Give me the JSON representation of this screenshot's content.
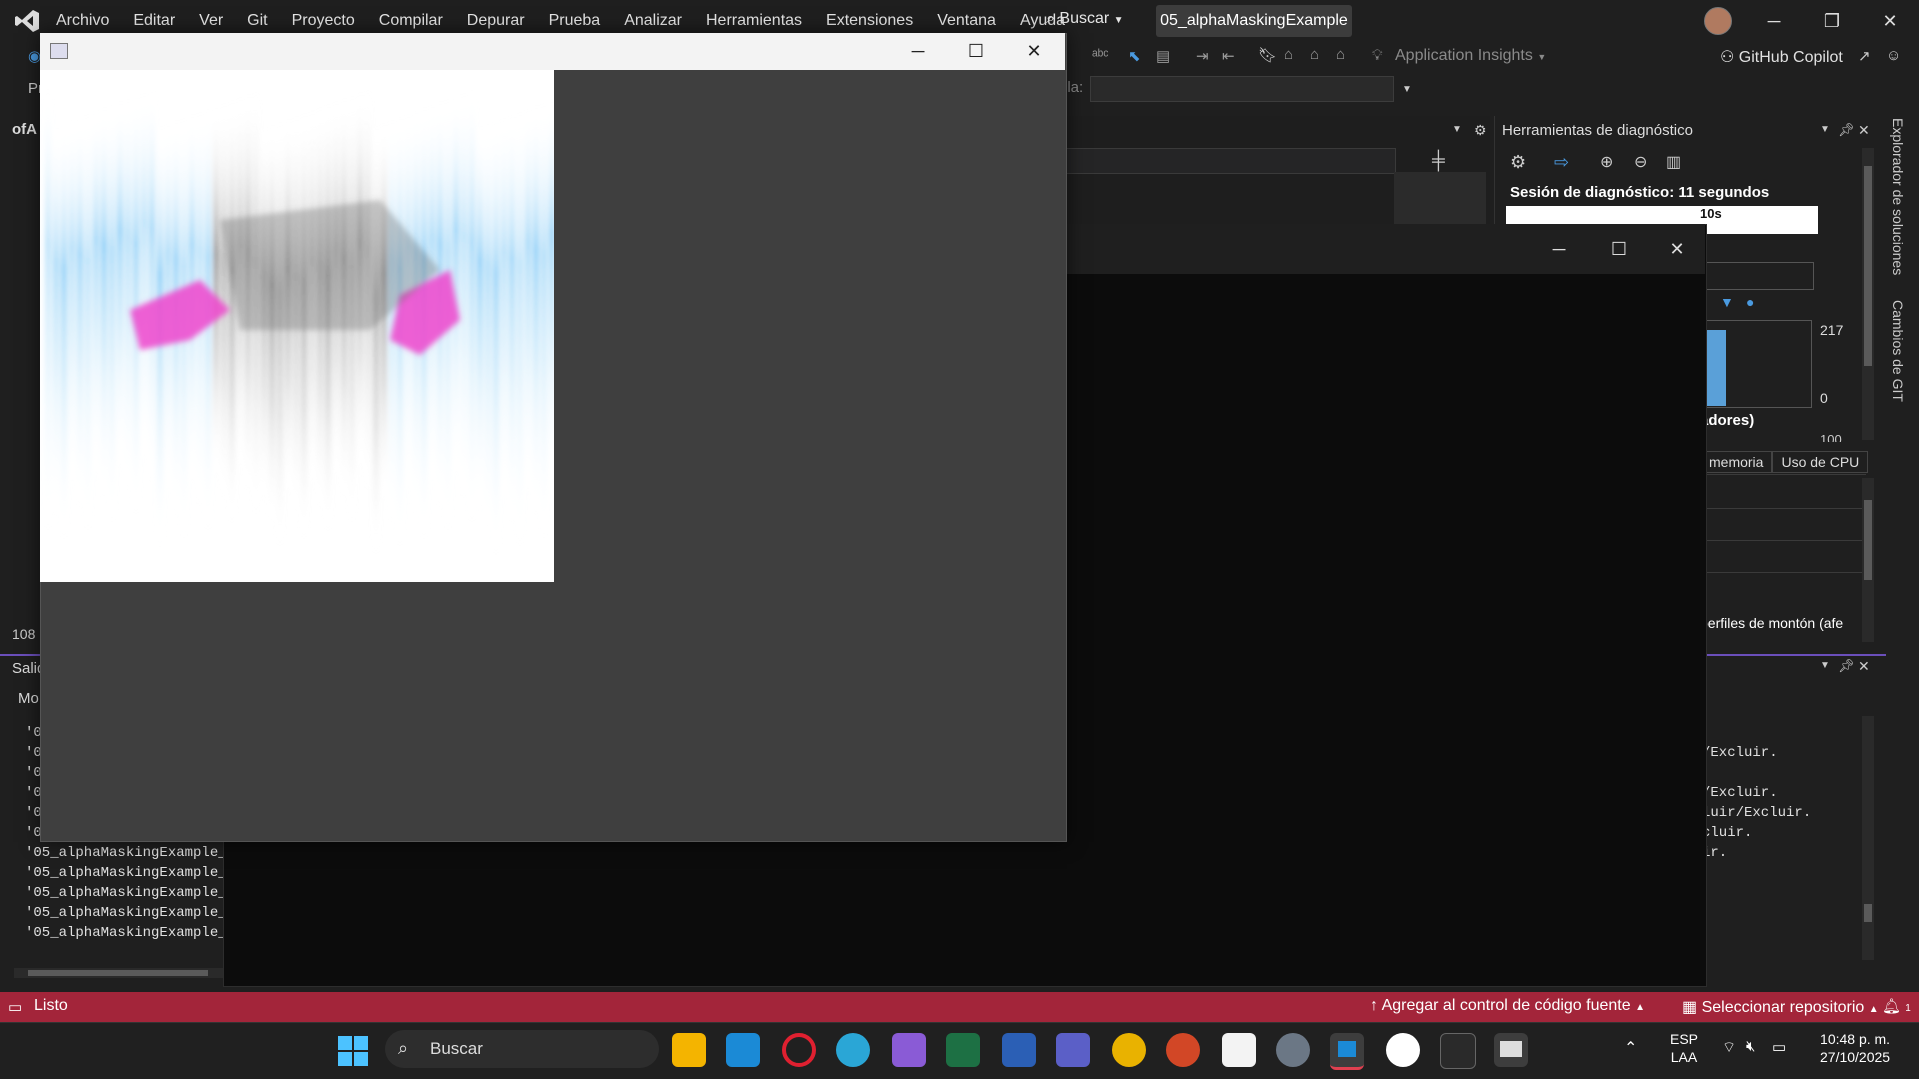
{
  "menu": [
    "Archivo",
    "Editar",
    "Ver",
    "Git",
    "Proyecto",
    "Compilar",
    "Depurar",
    "Prueba",
    "Analizar",
    "Herramientas",
    "Extensiones",
    "Ventana",
    "Ayuda"
  ],
  "search_label": "Buscar",
  "solution_title": "05_alphaMaskingExample",
  "toolbar": {
    "app_insights": "Application Insights",
    "copilot": "GitHub Copilot",
    "combo_label": "ila:"
  },
  "left_panel": {
    "tab": "ofA",
    "zoom": "108",
    "toolbar_cut": "Pr"
  },
  "output": {
    "title": "Salid",
    "source_label": "Mo",
    "lines": [
      "'0",
      "'0",
      "'0",
      "'0",
      "'0",
      "'0",
      "'05_alphaMaskingExample_d",
      "'05_alphaMaskingExample_d",
      "'05_alphaMaskingExample_d",
      "'05_alphaMaskingExample_d",
      "'05_alphaMaskingExample_d"
    ]
  },
  "diagnostics": {
    "title": "Herramientas de diagnóstico",
    "session": "Sesión de diagnóstico: 11 segundos",
    "tick": "10s",
    "max": "217",
    "min": "0",
    "section": "adores)",
    "next_val": "100",
    "tabs": [
      "memoria",
      "Uso de CPU"
    ],
    "heap": "perfiles de montón (afe"
  },
  "right_output": [
    "/Excluir.",
    "/Excluir.",
    "luir/Excluir.",
    "cluir.",
    "ir."
  ],
  "vertical_tabs": [
    "Explorador de soluciones",
    "Cambios de GIT"
  ],
  "status": {
    "ready": "Listo",
    "scm": "Agregar al control de código fuente",
    "repo": "Seleccionar repositorio",
    "notif": "1"
  },
  "taskbar": {
    "search": "Buscar",
    "lang1": "ESP",
    "lang2": "LAA",
    "time": "10:48 p. m.",
    "date": "27/10/2025"
  },
  "colors": {
    "statusbar": "#a3253a",
    "accent": "#6b4fbb",
    "magenta": "#ee44cc",
    "blue": "#3aaaf0"
  }
}
